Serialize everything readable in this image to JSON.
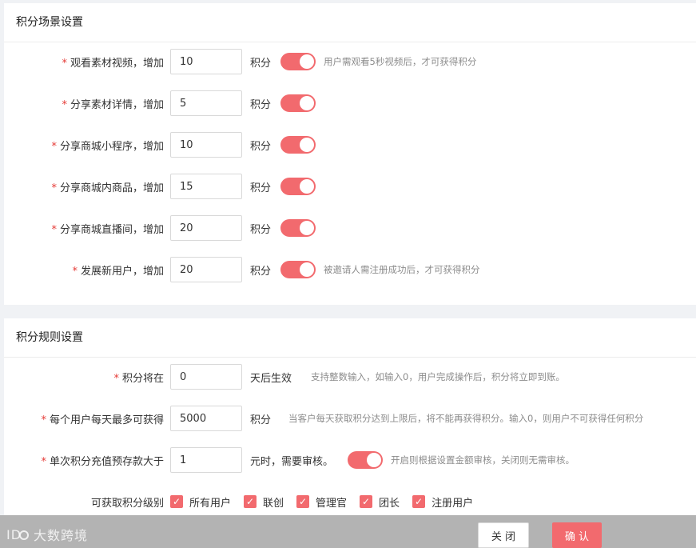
{
  "section_scene": {
    "title": "积分场景设置",
    "unit": "积分",
    "rows": [
      {
        "label": "观看素材视频，增加",
        "value": "10",
        "hint": "用户需观看5秒视频后，才可获得积分"
      },
      {
        "label": "分享素材详情，增加",
        "value": "5",
        "hint": ""
      },
      {
        "label": "分享商城小程序，增加",
        "value": "10",
        "hint": ""
      },
      {
        "label": "分享商城内商品，增加",
        "value": "15",
        "hint": ""
      },
      {
        "label": "分享商城直播间，增加",
        "value": "20",
        "hint": ""
      },
      {
        "label": "发展新用户，增加",
        "value": "20",
        "hint": "被邀请人需注册成功后，才可获得积分"
      }
    ]
  },
  "section_rules": {
    "title": "积分规则设置",
    "effective": {
      "label": "积分将在",
      "value": "0",
      "unit": "天后生效",
      "hint": "支持整数输入，如输入0，用户完成操作后，积分将立即到账。"
    },
    "daily_max": {
      "label": "每个用户每天最多可获得",
      "value": "5000",
      "unit": "积分",
      "hint": "当客户每天获取积分达到上限后，将不能再获得积分。输入0，则用户不可获得任何积分"
    },
    "recharge": {
      "label": "单次积分充值预存款大于",
      "value": "1",
      "unit": "元时，需要审核。",
      "hint": "开启则根据设置金额审核，关闭则无需审核。"
    },
    "levels": {
      "label": "可获取积分级别",
      "options": [
        "所有用户",
        "联创",
        "管理官",
        "团长",
        "注册用户"
      ]
    }
  },
  "required_mark": "*",
  "check_glyph": "✓",
  "footer": {
    "close_label": "关 闭",
    "confirm_label": "确 认"
  },
  "watermark": {
    "text": "大数跨境"
  },
  "colors": {
    "accent": "#f26a6e"
  }
}
